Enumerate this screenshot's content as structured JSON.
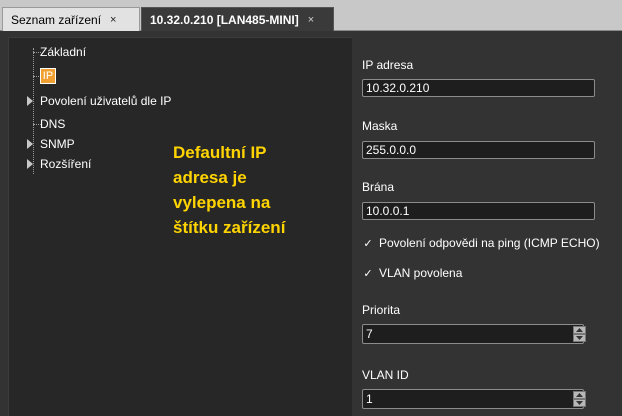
{
  "tabs": [
    {
      "label": "Seznam zařízení",
      "close": "×",
      "active": false
    },
    {
      "label": "10.32.0.210 [LAN485-MINI]",
      "close": "×",
      "active": true
    }
  ],
  "tree": {
    "items": [
      {
        "label": "Základní"
      },
      {
        "label": "IP"
      },
      {
        "label": "Povolení uživatelů dle IP"
      },
      {
        "label": "DNS"
      },
      {
        "label": "SNMP"
      },
      {
        "label": "Rozšíření"
      }
    ]
  },
  "annotation": {
    "lines": [
      "Defaultní IP",
      "adresa je",
      "vylepena na",
      "štítku zařízení"
    ]
  },
  "form": {
    "ip": {
      "label": "IP adresa",
      "value": "10.32.0.210"
    },
    "mask": {
      "label": "Maska",
      "value": "255.0.0.0"
    },
    "gateway": {
      "label": "Brána",
      "value": "10.0.0.1"
    },
    "ping": {
      "label": "Povolení odpovědi na ping (ICMP ECHO)",
      "mark": "✓",
      "checked": true
    },
    "vlan": {
      "label": "VLAN povolena",
      "mark": "✓",
      "checked": true
    },
    "priority": {
      "label": "Priorita",
      "value": "7"
    },
    "vlan_id": {
      "label": "VLAN ID",
      "value": "1"
    }
  },
  "colors": {
    "annotation": "#ffd400",
    "selection": "#f0a030",
    "background": "#333333"
  }
}
